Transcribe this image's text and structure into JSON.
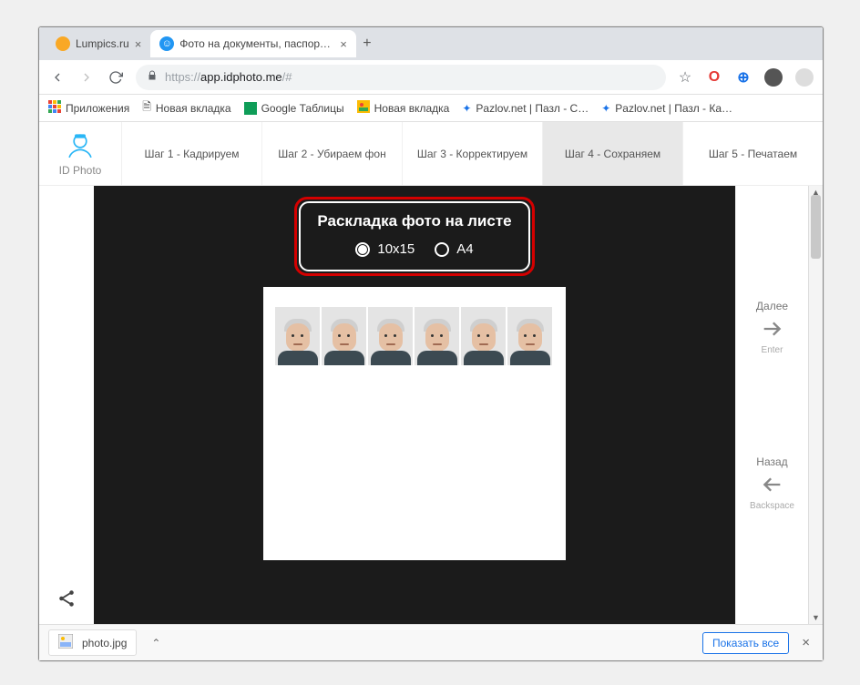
{
  "window_controls": {
    "min": "—",
    "max": "▭",
    "close": "✕"
  },
  "tabs": [
    {
      "title": "Lumpics.ru",
      "active": false,
      "favicon_bg": "#f9a825"
    },
    {
      "title": "Фото на документы, паспорта, з…",
      "active": true,
      "favicon_bg": "#2196f3"
    }
  ],
  "url": {
    "scheme": "https://",
    "host": "app.idphoto.me",
    "path": "/#"
  },
  "ext_icons": {
    "star": "☆",
    "opera": "O",
    "globe": "⊕",
    "avatar": "●",
    "more": "⋮"
  },
  "bookmarks": [
    {
      "label": "Приложения",
      "icon": "apps"
    },
    {
      "label": "Новая вкладка",
      "icon": "doc"
    },
    {
      "label": "Google Таблицы",
      "icon": "sheets"
    },
    {
      "label": "Новая вкладка",
      "icon": "pic"
    },
    {
      "label": "Pazlov.net | Пазл - С…",
      "icon": "puzzle"
    },
    {
      "label": "Pazlov.net | Пазл - Ка…",
      "icon": "puzzle"
    }
  ],
  "app": {
    "brand": "ID Photo",
    "steps": [
      "Шаг 1 - Кадрируем",
      "Шаг 2 - Убираем фон",
      "Шаг 3 - Корректируем",
      "Шаг 4 - Сохраняем",
      "Шаг 5 - Печатаем"
    ],
    "active_step": 3,
    "panel": {
      "title": "Раскладка фото на листе",
      "options": [
        {
          "label": "10х15",
          "selected": true
        },
        {
          "label": "A4",
          "selected": false
        }
      ]
    },
    "next": {
      "label": "Далее",
      "key": "Enter"
    },
    "back": {
      "label": "Назад",
      "key": "Backspace"
    }
  },
  "downloads": {
    "file": "photo.jpg",
    "show_all": "Показать все"
  }
}
